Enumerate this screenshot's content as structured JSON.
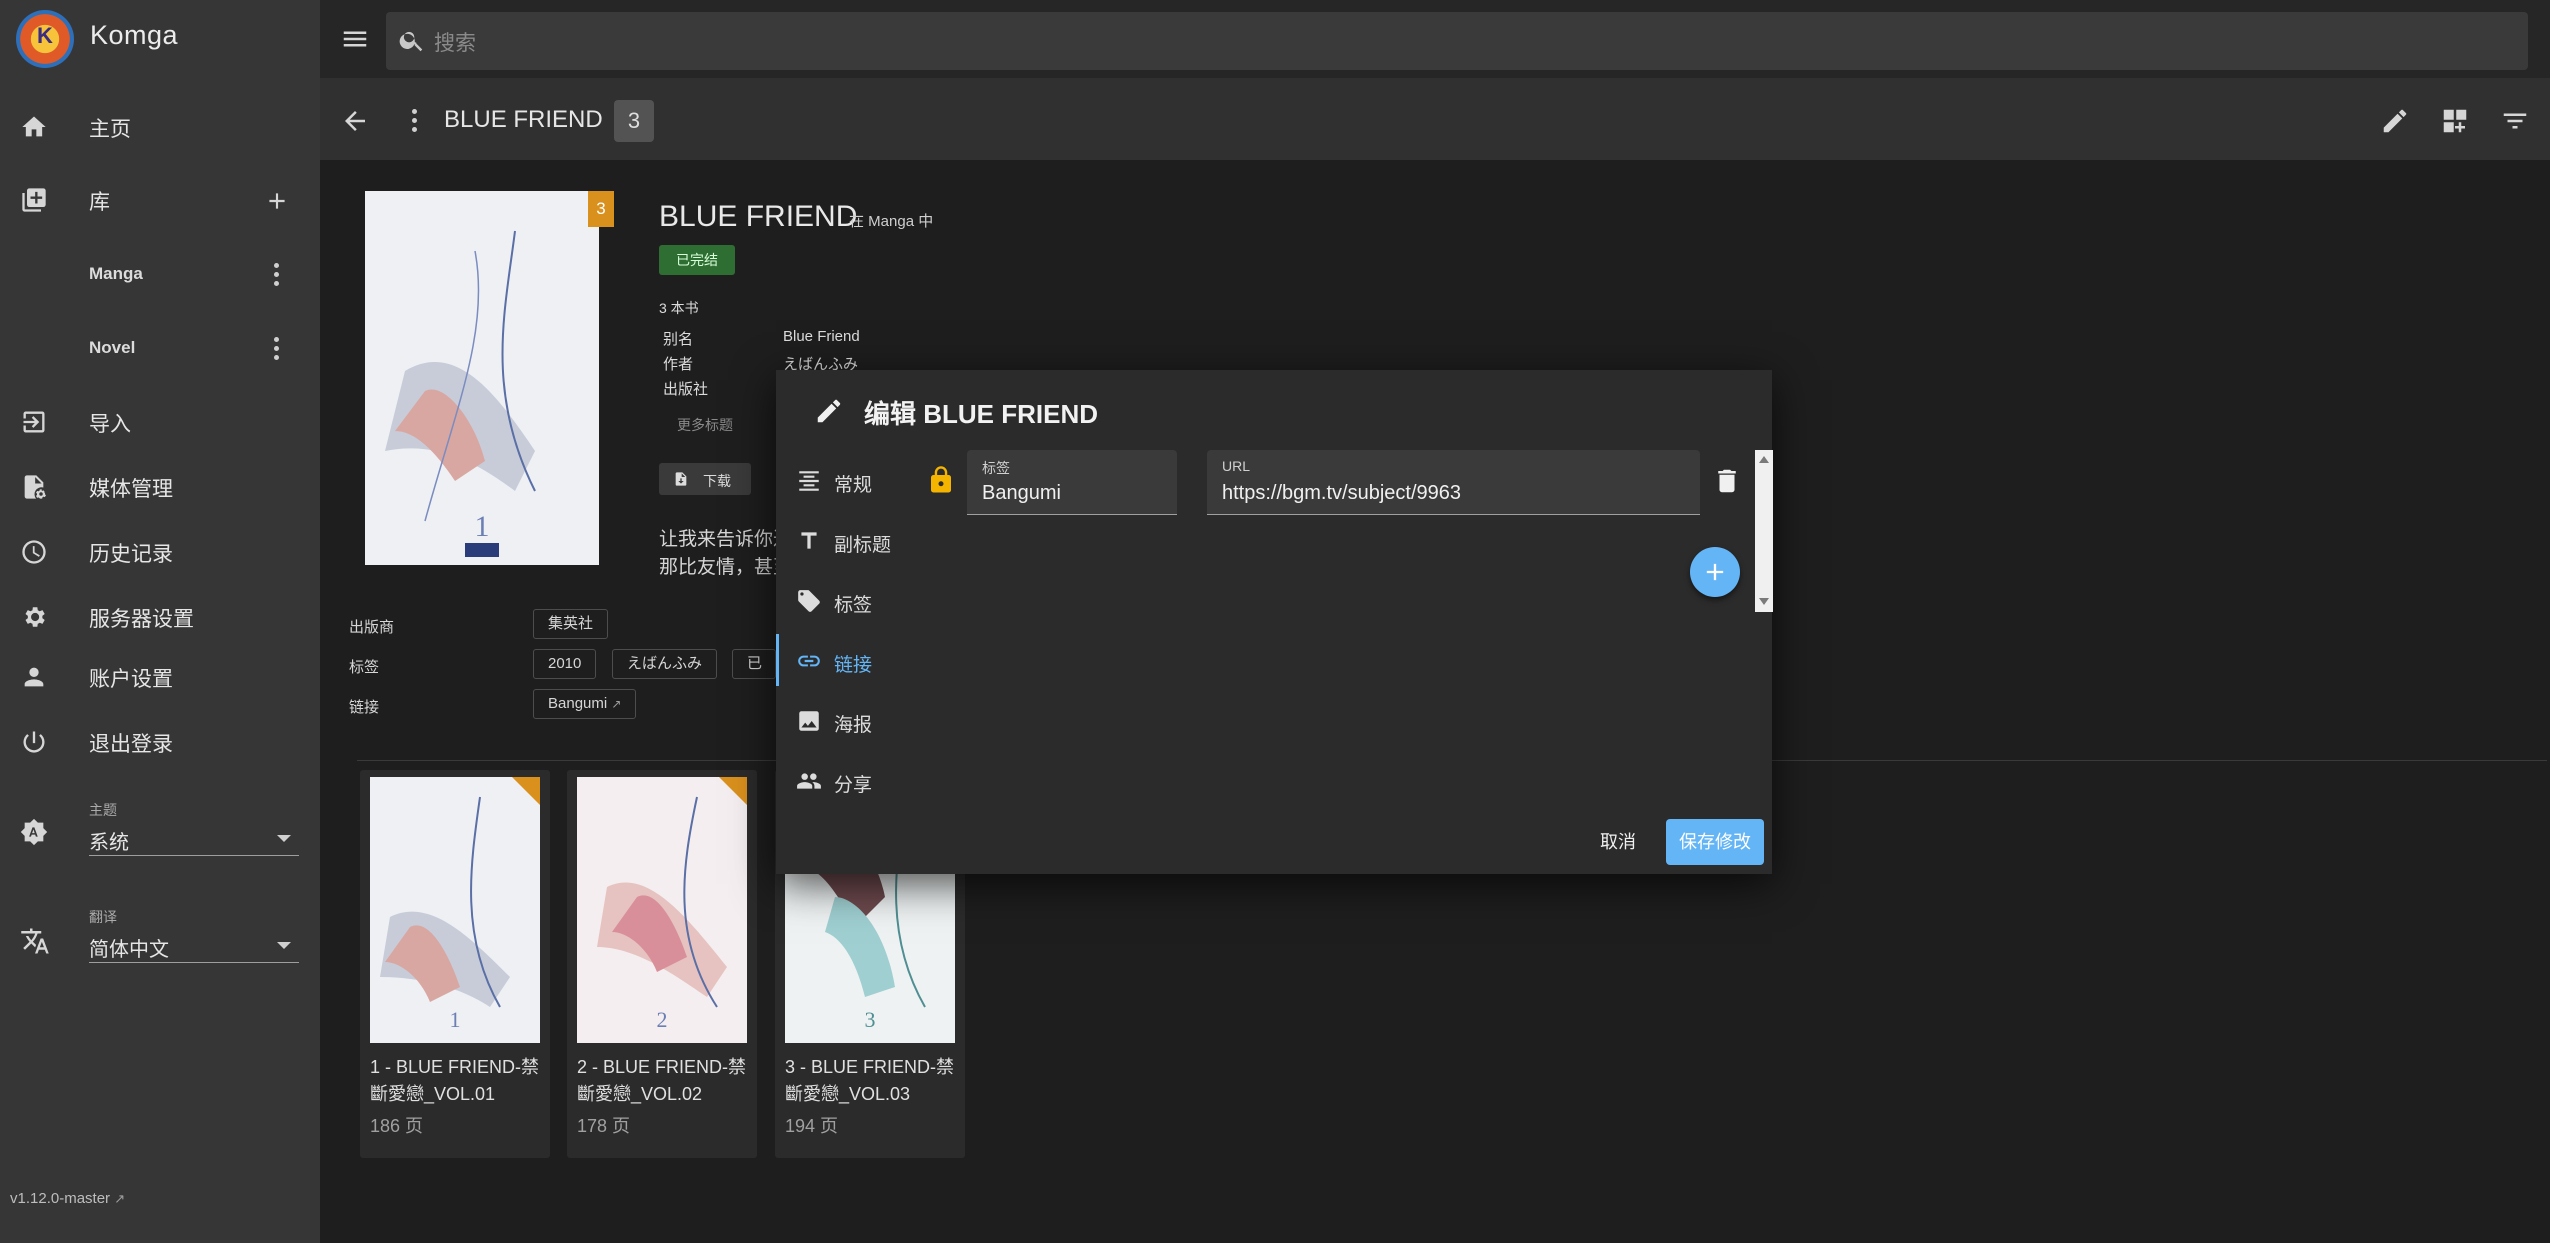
{
  "app": {
    "name": "Komga",
    "logo_text": "K",
    "version": "v1.12.0-master"
  },
  "search": {
    "placeholder": "搜索"
  },
  "sidebar": {
    "nav": [
      {
        "label": "主页",
        "icon": "home-icon"
      },
      {
        "label": "库",
        "icon": "library-icon"
      },
      {
        "label": "导入",
        "icon": "import-icon"
      },
      {
        "label": "媒体管理",
        "icon": "media-management-icon"
      },
      {
        "label": "历史记录",
        "icon": "history-icon"
      },
      {
        "label": "服务器设置",
        "icon": "gear-icon"
      },
      {
        "label": "账户设置",
        "icon": "account-icon"
      },
      {
        "label": "退出登录",
        "icon": "power-icon"
      }
    ],
    "libraries": [
      {
        "label": "Manga"
      },
      {
        "label": "Novel"
      }
    ],
    "theme": {
      "caption": "主题",
      "value": "系统"
    },
    "language": {
      "caption": "翻译",
      "value": "简体中文"
    }
  },
  "toolbar": {
    "title": "BLUE FRIEND",
    "count": "3"
  },
  "series": {
    "title": "BLUE FRIEND",
    "library_note": "在 Manga 中",
    "status": "已完结",
    "book_count": "3 本书",
    "cover_badge": "3",
    "details": [
      {
        "label": "别名",
        "value": "Blue Friend"
      },
      {
        "label": "作者",
        "value": "えばんふみ"
      },
      {
        "label": "出版社",
        "value": ""
      }
    ],
    "more_titles": "更多标题",
    "download_label": "下载",
    "summary_line1": "让我来告诉你过",
    "summary_line2": "那比友情，甚至",
    "publisher_label": "出版商",
    "publisher_value": "集英社",
    "tags_label": "标签",
    "tags": [
      "2010",
      "えばんふみ",
      "已完"
    ],
    "links_label": "链接",
    "link_value": "Bangumi"
  },
  "books": [
    {
      "title_line1": "1 - BLUE FRIEND-禁",
      "title_line2": "斷愛戀_VOL.01",
      "pages": "186 页",
      "num": "1"
    },
    {
      "title_line1": "2 - BLUE FRIEND-禁",
      "title_line2": "斷愛戀_VOL.02",
      "pages": "178 页",
      "num": "2"
    },
    {
      "title_line1": "3 - BLUE FRIEND-禁",
      "title_line2": "斷愛戀_VOL.03",
      "pages": "194 页",
      "num": "3"
    }
  ],
  "dialog": {
    "title": "编辑 BLUE FRIEND",
    "tabs": [
      {
        "label": "常规",
        "icon": "align-center-icon"
      },
      {
        "label": "副标题",
        "icon": "text-format-icon"
      },
      {
        "label": "标签",
        "icon": "tag-icon"
      },
      {
        "label": "链接",
        "icon": "link-icon"
      },
      {
        "label": "海报",
        "icon": "image-icon"
      },
      {
        "label": "分享",
        "icon": "people-icon"
      }
    ],
    "active_tab": "链接",
    "link_row": {
      "label_caption": "标签",
      "label_value": "Bangumi",
      "url_caption": "URL",
      "url_value": "https://bgm.tv/subject/9963"
    },
    "cancel_label": "取消",
    "save_label": "保存修改"
  },
  "colors": {
    "accent": "#64b5f6",
    "badge": "#d9901c",
    "status": "#2e6e32",
    "lock": "#f4b400"
  }
}
